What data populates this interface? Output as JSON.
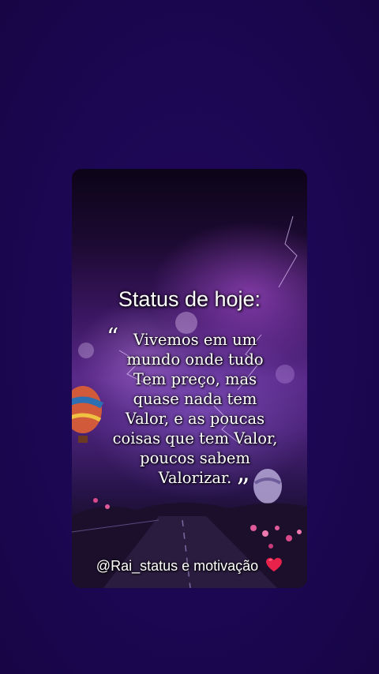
{
  "card": {
    "title": "Status de hoje:",
    "quote_lines": [
      "Vivemos em um",
      "mundo onde tudo",
      "Tem preço, mas",
      "quase nada tem",
      "Valor, e as poucas",
      "coisas que tem Valor,",
      "poucos sabem",
      "Valorizar."
    ],
    "open_quote": "“",
    "close_quote": "”",
    "footer": "@Rai_status e motivação",
    "heart_icon": "red-heart-icon"
  },
  "colors": {
    "page_background": "#1b0752",
    "text": "#ffffff",
    "heart": "#e8224a"
  }
}
